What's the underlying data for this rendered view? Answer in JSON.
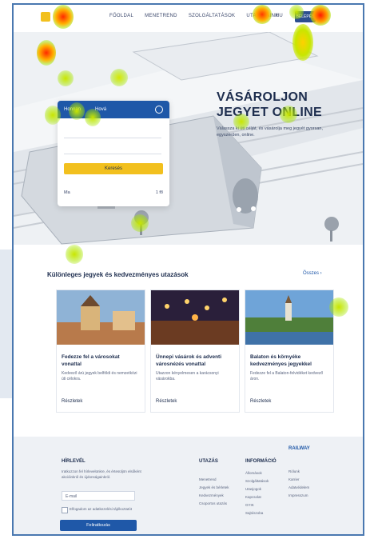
{
  "header": {
    "nav": [
      "FŐOLDAL",
      "MENETREND",
      "SZOLGÁLTATÁSOK",
      "UTAZÁSAINK"
    ],
    "lang": "HU",
    "login": "BELÉPÉS"
  },
  "hero": {
    "title": "VÁSÁROLJON JEGYET ONLINE",
    "subtitle": "Válassza ki úti célját, és vásárolja meg jegyét gyorsan, egyszerűen, online.",
    "booking": {
      "from_label": "Honnan",
      "to_label": "Hová",
      "from_value": "",
      "to_value": "",
      "button": "Keresés",
      "foot_left": "Ma",
      "foot_right": "1 fő"
    }
  },
  "specials": {
    "title": "Különleges jegyek és kedvezményes utazások",
    "more": "Összes ›",
    "tiles": [
      {
        "title": "Fedezze fel a városokat vonattal",
        "desc": "Kedvező árú jegyek belföldi és nemzetközi úti célokra.",
        "link": "Részletek",
        "img": "city"
      },
      {
        "title": "Ünnepi vásárok és adventi városnézés vonattal",
        "desc": "Utazzon kényelmesen a karácsonyi vásárokba.",
        "link": "Részletek",
        "img": "lights"
      },
      {
        "title": "Balaton és környéke kedvezményes jegyekkel",
        "desc": "Fedezze fel a Balaton-felvidéket kedvező áron.",
        "link": "Részletek",
        "img": "lake"
      }
    ]
  },
  "footer": {
    "newsletter_title": "HÍRLEVÉL",
    "newsletter_text": "Iratkozzon fel hírlevelünkre, és értesüljön elsőként akcióinkról és újdonságainkról.",
    "email_placeholder": "E-mail",
    "consent": "Elfogadom az adatkezelési tájékoztatót",
    "subscribe": "Feliratkozás",
    "col1_title": "UTAZÁS",
    "col1_items": [
      "Menetrend",
      "Jegyek és bérletek",
      "Kedvezmények",
      "Csoportos utazás"
    ],
    "col2_title": "INFORMÁCIÓ",
    "col2_items": [
      "Állomások",
      "Szolgáltatások",
      "Utasjogok",
      "Kapcsolat",
      "GYIK",
      "Sajtószoba"
    ],
    "brand": "RAILWAY",
    "brand_items": [
      "Rólunk",
      "Karrier",
      "Adatvédelem",
      "Impresszum"
    ]
  },
  "colors": {
    "brand": "#1f58a8",
    "accent": "#f2c01e",
    "dark": "#1d2d4e"
  }
}
